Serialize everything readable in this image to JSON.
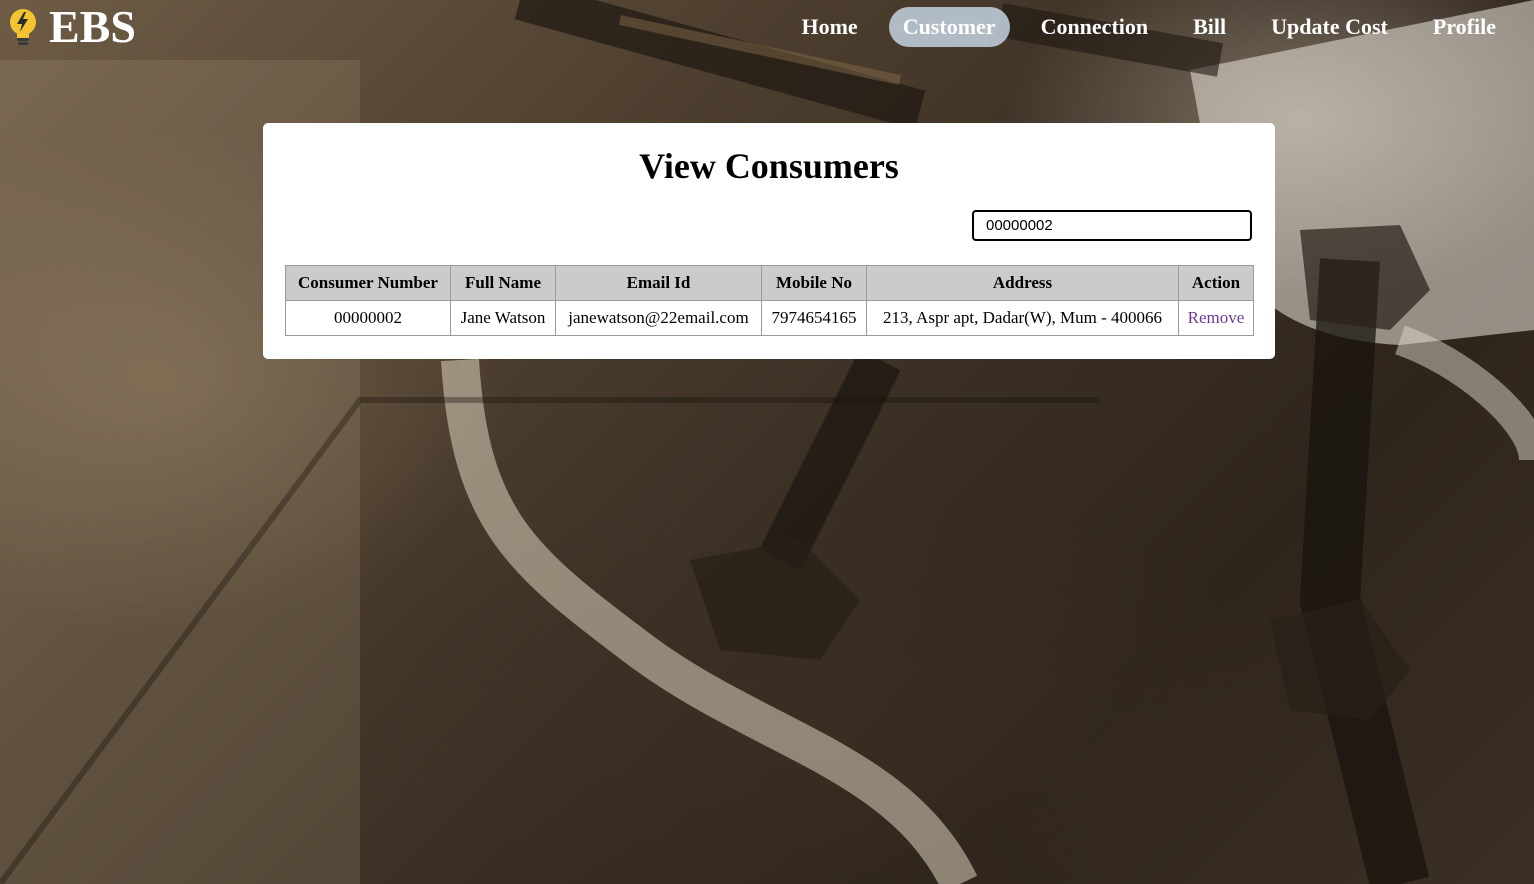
{
  "brand": {
    "name": "EBS",
    "icon": "lightbulb-icon"
  },
  "nav": {
    "items": [
      {
        "label": "Home",
        "active": false
      },
      {
        "label": "Customer",
        "active": true
      },
      {
        "label": "Connection",
        "active": false
      },
      {
        "label": "Bill",
        "active": false
      },
      {
        "label": "Update Cost",
        "active": false
      },
      {
        "label": "Profile",
        "active": false
      }
    ]
  },
  "main": {
    "title": "View Consumers",
    "search": {
      "value": "00000002",
      "placeholder": ""
    },
    "table": {
      "columns": [
        "Consumer Number",
        "Full Name",
        "Email Id",
        "Mobile No",
        "Address",
        "Action"
      ],
      "rows": [
        {
          "consumer_number": "00000002",
          "full_name": "Jane Watson",
          "email": "janewatson@22email.com",
          "mobile": "7974654165",
          "address": "213, Aspr apt, Dadar(W), Mum - 400066",
          "action": "Remove"
        }
      ]
    }
  },
  "colors": {
    "active_nav_bg": "#c3d2e1",
    "header_bg": "#cbcbcb",
    "action_link": "#6b3b9a",
    "bulb": "#f4c430"
  }
}
